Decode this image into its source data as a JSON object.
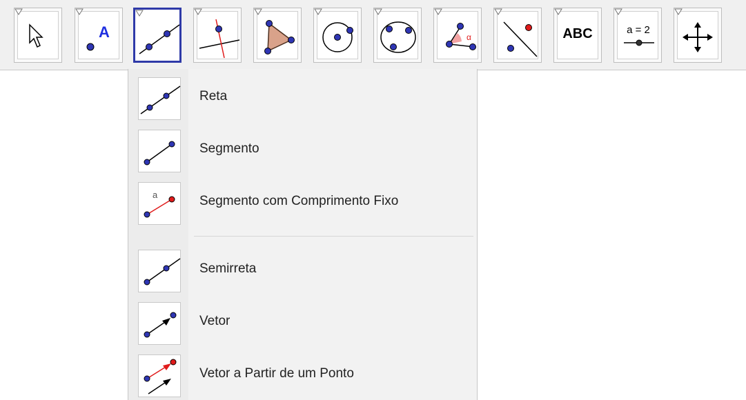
{
  "toolbar": {
    "tools": [
      {
        "name": "move",
        "icon": "arrow-cursor-icon"
      },
      {
        "name": "point",
        "icon": "point-icon",
        "label": "A"
      },
      {
        "name": "line",
        "icon": "line-through-two-points-icon",
        "active": true
      },
      {
        "name": "perpendicular",
        "icon": "perpendicular-line-icon"
      },
      {
        "name": "polygon",
        "icon": "polygon-icon"
      },
      {
        "name": "circle",
        "icon": "circle-center-point-icon"
      },
      {
        "name": "circle-three-points",
        "icon": "circle-three-points-icon"
      },
      {
        "name": "angle",
        "icon": "angle-icon",
        "label": "α"
      },
      {
        "name": "reflect",
        "icon": "reflect-about-line-icon"
      },
      {
        "name": "text",
        "icon": "text-icon",
        "label": "ABC"
      },
      {
        "name": "slider",
        "icon": "slider-icon",
        "label": "a = 2"
      },
      {
        "name": "move-graphics",
        "icon": "move-graphics-view-icon"
      }
    ]
  },
  "submenu": {
    "items": [
      {
        "label": "Reta",
        "icon": "line-icon"
      },
      {
        "label": "Segmento",
        "icon": "segment-icon"
      },
      {
        "label": "Segmento com Comprimento Fixo",
        "icon": "segment-fixed-length-icon",
        "icon_label": "a"
      },
      {
        "label": "Semirreta",
        "icon": "ray-icon"
      },
      {
        "label": "Vetor",
        "icon": "vector-icon"
      },
      {
        "label": "Vetor a Partir de um Ponto",
        "icon": "vector-from-point-icon"
      }
    ]
  },
  "colors": {
    "point_blue": "#2f36b4",
    "active_border": "#2f3aa8",
    "polygon_fill": "#d9a28a",
    "red": "#e01b1b"
  }
}
